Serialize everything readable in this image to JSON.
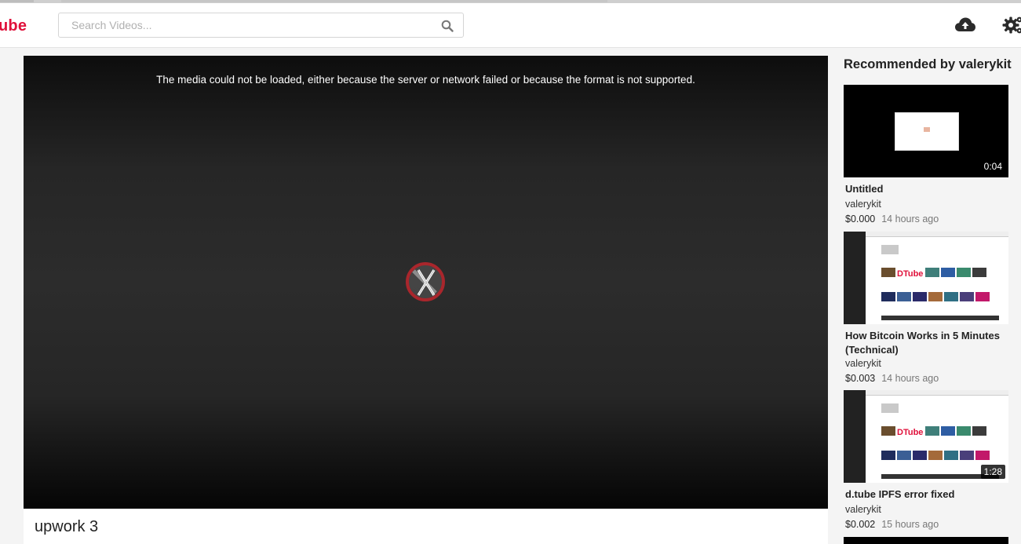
{
  "brand": {
    "logo_text": "ube",
    "color": "#e0103a"
  },
  "search": {
    "placeholder": "Search Videos..."
  },
  "header_icons": [
    "upload-cloud-icon",
    "settings-gear-icon"
  ],
  "player": {
    "error_message": "The media could not be loaded, either because the server or network failed or because the format is not supported.",
    "error_icon": "media-error-icon"
  },
  "video": {
    "title": "upwork 3"
  },
  "recommended": {
    "heading": "Recommended by valerykit",
    "items": [
      {
        "title": "Untitled",
        "author": "valerykit",
        "payout": "$0.000",
        "ago": "14 hours ago",
        "duration": "0:04"
      },
      {
        "title": "How Bitcoin Works in 5 Minutes (Technical)",
        "author": "valerykit",
        "payout": "$0.003",
        "ago": "14 hours ago",
        "duration": ""
      },
      {
        "title": "d.tube IPFS error fixed",
        "author": "valerykit",
        "payout": "$0.002",
        "ago": "15 hours ago",
        "duration": "1:28"
      }
    ]
  }
}
